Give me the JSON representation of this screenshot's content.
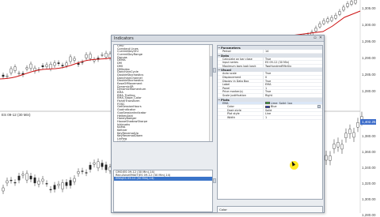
{
  "chart": {
    "top_panel_label": "",
    "bottom_panel_label": "ES 09-12 (30 Min)",
    "price_ticks_top": [
      "1,305.00",
      "1,300.00",
      "1,295.00",
      "1,290.00",
      "1,285.00",
      "1,280.00"
    ],
    "price_ticks_bottom": [
      "1,400.00",
      "1,380.00",
      "1,360.00",
      "1,340.00",
      "1,320.00",
      "1,300.00",
      "1,280.00"
    ],
    "flag_top": "",
    "flag_bottom": "1,402.25",
    "colors": {
      "ema_line": "#cc1111",
      "flag": "#3b6bc9"
    }
  },
  "dialog": {
    "title": "Indicators",
    "close_icon": "close-icon",
    "indicator_list": [
      "CMO",
      "Constant Lines",
      "CurrentDayOhl",
      "CurrentDayRange",
      "Darvas",
      "DEMA",
      "DM",
      "DMI",
      "DMIndex",
      "DonchianCycle",
      "DoubleStochastics",
      "DonchianChannel",
      "DoubleStochastics",
      "EaseOfMovement",
      "DynamicSR",
      "DynamicMomentum",
      "EMA",
      "EMA_Trailing",
      "EMA_Slope_Color",
      "FisherTransform",
      "FOSC",
      "GetSessionHours",
      "GuoIndicator",
      "GuoSessionIndicator",
      "HeikenAshi",
      "HoneyBadger",
      "HouseShadowSharpe",
      "Ichimoku",
      "KAMA",
      "Keltner",
      "KeyReversalUp",
      "KeyReversalDown",
      "LinReg",
      "MACD",
      "Pivot"
    ],
    "selected_indicators": [
      "CMO(ES 09-12 (30 Min),14)",
      "RecursiveEMAIT(ES 09-12 (30 Min),14)",
      "EMA(ES 09-12 (30 Min),14)"
    ],
    "properties": {
      "sections": [
        {
          "name": "Parameters",
          "rows": [
            {
              "name": "Period",
              "value": "14"
            }
          ]
        },
        {
          "name": "Data",
          "rows": [
            {
              "name": "Calculate on bar close",
              "value": "True"
            },
            {
              "name": "Input series",
              "value": "ES 09-12 (30 Min)"
            },
            {
              "name": "Maximum bars look back",
              "value": "TwoHundredFiftySix"
            }
          ]
        },
        {
          "name": "Visual",
          "rows": [
            {
              "name": "Auto scale",
              "value": "True"
            },
            {
              "name": "Displacement",
              "value": "0"
            },
            {
              "name": "Display in Data Box",
              "value": "True"
            },
            {
              "name": "Label",
              "value": "EMA"
            },
            {
              "name": "Panel",
              "value": "1"
            },
            {
              "name": "Price marker(s)",
              "value": "True"
            },
            {
              "name": "Scale justification",
              "value": "Right"
            }
          ]
        },
        {
          "name": "Plots",
          "rows": [
            {
              "name": "EMA",
              "value": "Lime; Solid; 1px",
              "selected": true,
              "swatch": "#33cc33"
            },
            {
              "name": "Color",
              "value": "Blue",
              "sub": true,
              "swatch": "#2233dd",
              "dropdown": true
            },
            {
              "name": "Dash style",
              "value": "Solid",
              "sub": true
            },
            {
              "name": "Plot style",
              "value": "Line",
              "sub": true
            },
            {
              "name": "Width",
              "value": "1",
              "sub": true
            }
          ]
        }
      ]
    },
    "description_label": "Color"
  }
}
